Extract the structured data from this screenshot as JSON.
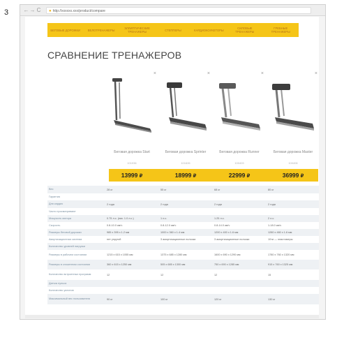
{
  "figure_number": "3",
  "browser": {
    "back": "←",
    "forward": "→",
    "reload": "C",
    "url": "http://xxxxxx.xxx/product/compare"
  },
  "menu": [
    "Беговые дорожки",
    "Велотренажеры",
    "Эллиптические тренажеры",
    "Степперы",
    "Кардиокоукеторы",
    "Силовые тренажеры",
    "Гребные тренажеры"
  ],
  "page_title": "СРАВНЕНИЕ ТРЕНАЖЕРОВ",
  "products": [
    {
      "name": "Беговая дорожка Start",
      "code": "101936",
      "price": "13999",
      "currency": "₽",
      "close": "×"
    },
    {
      "name": "Беговая дорожка Sprinter",
      "code": "101626",
      "price": "18999",
      "currency": "₽",
      "close": "×"
    },
    {
      "name": "Беговая дорожка Runner",
      "code": "100403",
      "price": "22999",
      "currency": "₽",
      "close": "×"
    },
    {
      "name": "Беговая дорожка Master",
      "code": "100406",
      "price": "36999",
      "currency": "₽",
      "close": "×"
    }
  ],
  "specs": [
    {
      "label": "Вес",
      "values": [
        "28 кг",
        "55 кг",
        "68 кг",
        "80 кг"
      ]
    },
    {
      "label": "Гарантия",
      "values": [
        "",
        "",
        "",
        ""
      ]
    },
    {
      "label": "Для кардио",
      "values": [
        "2 года",
        "2 года",
        "2 года",
        "2 года"
      ]
    },
    {
      "label": "Часто просматривают",
      "values": [
        "",
        "",
        "",
        ""
      ]
    },
    {
      "label": "Мощность мотора",
      "values": [
        "0.75 л.с. (пик. 1.0 л.с.)",
        "1 л.с.",
        "1.25 л.с.",
        "2 л.с."
      ]
    },
    {
      "label": "Скорость",
      "values": [
        "0.8-10.0 км/ч",
        "0.8-12.0 км/ч",
        "0.8-14.0 км/ч",
        "1-18.0 км/ч"
      ]
    },
    {
      "label": "Размеры беговой дорожки",
      "values": [
        "985 x 395 x 1.2 мм",
        "1000 x 360 x 1.4 мм",
        "1200 x 400 x 1.6 мм",
        "1280 x 460 x 1.6 мм"
      ]
    },
    {
      "label": "Амортизационная система",
      "values": [
        "нет упругой",
        "3 амортизационные полоски",
        "3 амортизационные полоски",
        "10ти — эластомеры"
      ]
    },
    {
      "label": "Количество уровней нагрузки",
      "values": [
        "",
        "",
        "",
        ""
      ]
    },
    {
      "label": "Размеры в рабочем состоянии",
      "values": [
        "1215 x 615 x 1055 мм",
        "1375 x 685 x 1280 мм",
        "1600 x 690 x 1290 мм",
        "1780 x 760 x 1320 мм"
      ]
    },
    {
      "label": "Размеры в сложенном состоянии",
      "values": [
        "360 x 615 x 1250 мм",
        "505 x 685 x 1300 мм",
        "750 x 690 x 1285 мм",
        "915 x 760 x 1325 мм"
      ]
    },
    {
      "label": "Количество встроенных программ",
      "values": [
        "12",
        "12",
        "12",
        "15"
      ]
    },
    {
      "label": "Датчик пульса",
      "values": [
        "",
        "",
        "",
        ""
      ]
    },
    {
      "label": "Количество уклонов",
      "values": [
        "",
        "",
        "",
        ""
      ]
    },
    {
      "label": "Максимальный вес пользователя",
      "values": [
        "90 кг",
        "100 кг",
        "120 кг",
        "130 кг"
      ]
    }
  ]
}
